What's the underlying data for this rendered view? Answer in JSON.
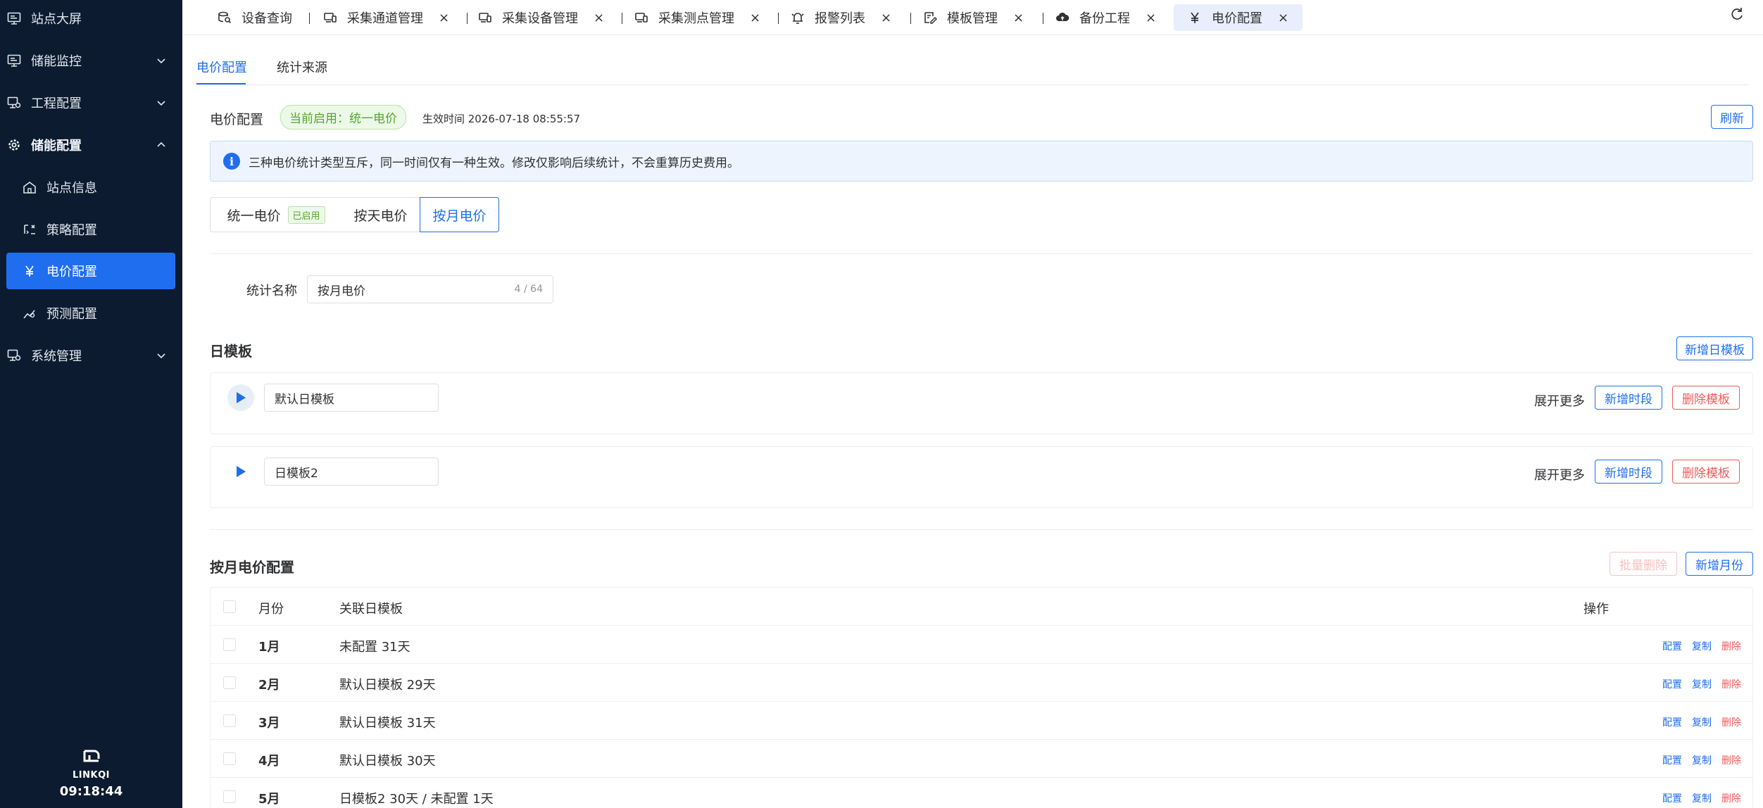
{
  "sidebar": {
    "items": [
      {
        "label": "站点大屏",
        "icon": "monitor-icon"
      },
      {
        "label": "储能监控",
        "icon": "monitor-icon"
      },
      {
        "label": "工程配置",
        "icon": "desktop-config-icon"
      },
      {
        "label": "储能配置",
        "icon": "gear-icon"
      },
      {
        "label": "站点信息",
        "icon": "home-icon"
      },
      {
        "label": "策略配置",
        "icon": "strategy-icon"
      },
      {
        "label": "电价配置",
        "icon": "yen-icon"
      },
      {
        "label": "预测配置",
        "icon": "forecast-icon"
      },
      {
        "label": "系统管理",
        "icon": "desktop-config-icon"
      }
    ],
    "logo_text": "LINKQI",
    "clock": "09:18:44"
  },
  "tabs": [
    {
      "label": "设备查询"
    },
    {
      "label": "采集通道管理"
    },
    {
      "label": "采集设备管理"
    },
    {
      "label": "采集测点管理"
    },
    {
      "label": "报警列表"
    },
    {
      "label": "模板管理"
    },
    {
      "label": "备份工程"
    },
    {
      "label": "电价配置"
    }
  ],
  "tab_close": "×",
  "subtabs": [
    "电价配置",
    "统计来源"
  ],
  "header": {
    "title": "电价配置",
    "current_badge": "当前启用：统一电价",
    "effective_time": "生效时间 2026-07-18 08:55:57",
    "refresh": "刷新"
  },
  "alert": {
    "icon": "i",
    "text": "三种电价统计类型互斥，同一时间仅有一种生效。修改仅影响后续统计，不会重算历史费用。"
  },
  "segments": [
    {
      "label": "统一电价",
      "tag": "已启用"
    },
    {
      "label": "按天电价"
    },
    {
      "label": "按月电价"
    }
  ],
  "form": {
    "stat_name_label": "统计名称",
    "stat_name_value": "按月电价",
    "stat_name_counter": "4 / 64"
  },
  "day_templates": {
    "title": "日模板",
    "add_button": "新增日模板",
    "expand_more": "展开更多",
    "add_period": "新增时段",
    "delete_template": "删除模板",
    "items": [
      {
        "name": "默认日模板"
      },
      {
        "name": "日模板2"
      }
    ]
  },
  "monthly": {
    "title": "按月电价配置",
    "batch_delete": "批量删除",
    "add_month": "新增月份",
    "columns": {
      "month": "月份",
      "template": "关联日模板",
      "ops": "操作"
    },
    "op_config": "配置",
    "op_copy": "复制",
    "op_delete": "删除",
    "rows": [
      {
        "month": "1月",
        "template": "未配置 31天"
      },
      {
        "month": "2月",
        "template": "默认日模板 29天"
      },
      {
        "month": "3月",
        "template": "默认日模板 31天"
      },
      {
        "month": "4月",
        "template": "默认日模板 30天"
      },
      {
        "month": "5月",
        "template": "日模板2 30天 / 未配置 1天"
      }
    ]
  },
  "colors": {
    "accent": "#1f6ef0",
    "sidebar_bg": "#0c1b2f",
    "danger": "#f05a5a",
    "success": "#52a72e"
  }
}
